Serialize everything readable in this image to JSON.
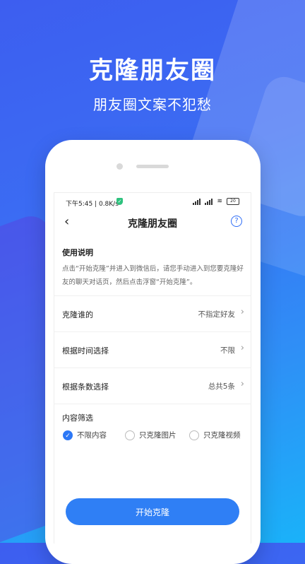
{
  "hero": {
    "title": "克隆朋友圈",
    "subtitle": "朋友圈文案不犯愁"
  },
  "status_bar": {
    "time": "下午5:45 | 0.8K/s",
    "battery": "20"
  },
  "nav": {
    "back_icon": "‹",
    "title": "克隆朋友圈",
    "help_icon": "?"
  },
  "instructions": {
    "title": "使用说明",
    "text": "点击“开始克隆”并进入到微信后，请您手动进入到您要克隆好友的聊天对话页，然后点击浮窗“开始克隆”。"
  },
  "settings": [
    {
      "label": "克隆谁的",
      "value": "不指定好友"
    },
    {
      "label": "根据时间选择",
      "value": "不限"
    },
    {
      "label": "根据条数选择",
      "value": "总共5条"
    }
  ],
  "content_filter": {
    "title": "内容筛选",
    "options": [
      {
        "label": "不限内容",
        "checked": true
      },
      {
        "label": "只克隆图片",
        "checked": false
      },
      {
        "label": "只克隆视频",
        "checked": false
      }
    ]
  },
  "actions": {
    "start_label": "开始克隆"
  },
  "colors": {
    "accent": "#2f7ff5",
    "hero_gradient_start": "#3d5ef0",
    "hero_gradient_end": "#1ab2f9"
  }
}
